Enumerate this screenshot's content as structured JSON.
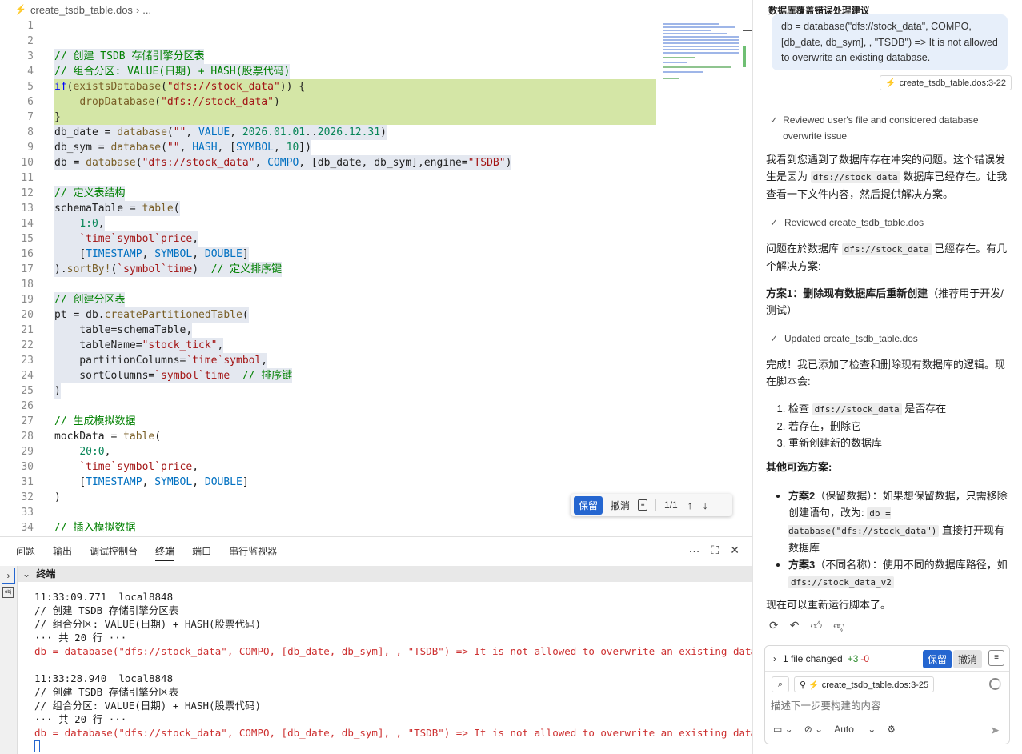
{
  "editor": {
    "breadcrumb_file": "create_tsdb_table.dos",
    "breadcrumb_more": "...",
    "lines": [
      {
        "n": "1",
        "segs": []
      },
      {
        "n": "2",
        "segs": []
      },
      {
        "n": "3",
        "segs": [
          {
            "t": "// 创建 TSDB 存储引擎分区表",
            "c": "c-comment"
          }
        ],
        "hl": "gray"
      },
      {
        "n": "4",
        "segs": [
          {
            "t": "// 组合分区: VALUE(日期) + HASH(股票代码)",
            "c": "c-comment"
          }
        ],
        "hl": "gray"
      },
      {
        "n": "5",
        "segs": [
          {
            "t": "if",
            "c": "c-kw"
          },
          {
            "t": "("
          },
          {
            "t": "existsDatabase",
            "c": "c-fn"
          },
          {
            "t": "("
          },
          {
            "t": "\"dfs://stock_data\"",
            "c": "c-str"
          },
          {
            "t": ")) {"
          }
        ],
        "hl": "green"
      },
      {
        "n": "6",
        "segs": [
          {
            "t": "    "
          },
          {
            "t": "dropDatabase",
            "c": "c-fn"
          },
          {
            "t": "("
          },
          {
            "t": "\"dfs://stock_data\"",
            "c": "c-str"
          },
          {
            "t": ")"
          }
        ],
        "hl": "green"
      },
      {
        "n": "7",
        "segs": [
          {
            "t": "}"
          }
        ],
        "hl": "green"
      },
      {
        "n": "8",
        "segs": [
          {
            "t": "db_date = "
          },
          {
            "t": "database",
            "c": "c-fn"
          },
          {
            "t": "("
          },
          {
            "t": "\"\"",
            "c": "c-str"
          },
          {
            "t": ", "
          },
          {
            "t": "VALUE",
            "c": "c-const"
          },
          {
            "t": ", "
          },
          {
            "t": "2026.01.01",
            "c": "c-num"
          },
          {
            "t": ".."
          },
          {
            "t": "2026.12.31",
            "c": "c-num"
          },
          {
            "t": ")"
          }
        ],
        "hl": "gray"
      },
      {
        "n": "9",
        "segs": [
          {
            "t": "db_sym = "
          },
          {
            "t": "database",
            "c": "c-fn"
          },
          {
            "t": "("
          },
          {
            "t": "\"\"",
            "c": "c-str"
          },
          {
            "t": ", "
          },
          {
            "t": "HASH",
            "c": "c-const"
          },
          {
            "t": ", ["
          },
          {
            "t": "SYMBOL",
            "c": "c-const"
          },
          {
            "t": ", "
          },
          {
            "t": "10",
            "c": "c-num"
          },
          {
            "t": "])"
          }
        ],
        "hl": "gray"
      },
      {
        "n": "10",
        "segs": [
          {
            "t": "db = "
          },
          {
            "t": "database",
            "c": "c-fn"
          },
          {
            "t": "("
          },
          {
            "t": "\"dfs://stock_data\"",
            "c": "c-str"
          },
          {
            "t": ", "
          },
          {
            "t": "COMPO",
            "c": "c-const"
          },
          {
            "t": ", [db_date, db_sym],engine="
          },
          {
            "t": "\"TSDB\"",
            "c": "c-str"
          },
          {
            "t": ")"
          }
        ],
        "hl": "gray"
      },
      {
        "n": "11",
        "segs": []
      },
      {
        "n": "12",
        "segs": [
          {
            "t": "// 定义表结构",
            "c": "c-comment"
          }
        ],
        "hl": "gray"
      },
      {
        "n": "13",
        "segs": [
          {
            "t": "schemaTable = "
          },
          {
            "t": "table",
            "c": "c-fn"
          },
          {
            "t": "("
          }
        ],
        "hl": "gray"
      },
      {
        "n": "14",
        "segs": [
          {
            "t": "    "
          },
          {
            "t": "1:0",
            "c": "c-num"
          },
          {
            "t": ","
          }
        ],
        "hl": "gray"
      },
      {
        "n": "15",
        "segs": [
          {
            "t": "    "
          },
          {
            "t": "`time`symbol`price",
            "c": "c-sym"
          },
          {
            "t": ","
          }
        ],
        "hl": "gray"
      },
      {
        "n": "16",
        "segs": [
          {
            "t": "    ["
          },
          {
            "t": "TIMESTAMP",
            "c": "c-const"
          },
          {
            "t": ", "
          },
          {
            "t": "SYMBOL",
            "c": "c-const"
          },
          {
            "t": ", "
          },
          {
            "t": "DOUBLE",
            "c": "c-const"
          },
          {
            "t": "]"
          }
        ],
        "hl": "gray"
      },
      {
        "n": "17",
        "segs": [
          {
            "t": ")."
          },
          {
            "t": "sortBy!",
            "c": "c-fn"
          },
          {
            "t": "("
          },
          {
            "t": "`symbol`time",
            "c": "c-sym"
          },
          {
            "t": ")  "
          },
          {
            "t": "// 定义排序键",
            "c": "c-comment"
          }
        ],
        "hl": "gray"
      },
      {
        "n": "18",
        "segs": []
      },
      {
        "n": "19",
        "segs": [
          {
            "t": "// 创建分区表",
            "c": "c-comment"
          }
        ],
        "hl": "gray"
      },
      {
        "n": "20",
        "segs": [
          {
            "t": "pt = db."
          },
          {
            "t": "createPartitionedTable",
            "c": "c-fn"
          },
          {
            "t": "("
          }
        ],
        "hl": "gray"
      },
      {
        "n": "21",
        "segs": [
          {
            "t": "    table=schemaTable,"
          }
        ],
        "hl": "gray"
      },
      {
        "n": "22",
        "segs": [
          {
            "t": "    tableName="
          },
          {
            "t": "\"stock_tick\"",
            "c": "c-str"
          },
          {
            "t": ","
          }
        ],
        "hl": "gray"
      },
      {
        "n": "23",
        "segs": [
          {
            "t": "    partitionColumns="
          },
          {
            "t": "`time`symbol",
            "c": "c-sym"
          },
          {
            "t": ","
          }
        ],
        "hl": "gray"
      },
      {
        "n": "24",
        "segs": [
          {
            "t": "    sortColumns="
          },
          {
            "t": "`symbol`time",
            "c": "c-sym"
          },
          {
            "t": "  "
          },
          {
            "t": "// 排序键",
            "c": "c-comment"
          }
        ],
        "hl": "gray"
      },
      {
        "n": "25",
        "segs": [
          {
            "t": ")"
          }
        ],
        "hl": "gray"
      },
      {
        "n": "26",
        "segs": []
      },
      {
        "n": "27",
        "segs": [
          {
            "t": "// 生成模拟数据",
            "c": "c-comment"
          }
        ]
      },
      {
        "n": "28",
        "segs": [
          {
            "t": "mockData = "
          },
          {
            "t": "table",
            "c": "c-fn"
          },
          {
            "t": "("
          }
        ]
      },
      {
        "n": "29",
        "segs": [
          {
            "t": "    "
          },
          {
            "t": "20:0",
            "c": "c-num"
          },
          {
            "t": ","
          }
        ]
      },
      {
        "n": "30",
        "segs": [
          {
            "t": "    "
          },
          {
            "t": "`time`symbol`price",
            "c": "c-sym"
          },
          {
            "t": ","
          }
        ]
      },
      {
        "n": "31",
        "segs": [
          {
            "t": "    ["
          },
          {
            "t": "TIMESTAMP",
            "c": "c-const"
          },
          {
            "t": ", "
          },
          {
            "t": "SYMBOL",
            "c": "c-const"
          },
          {
            "t": ", "
          },
          {
            "t": "DOUBLE",
            "c": "c-const"
          },
          {
            "t": "]"
          }
        ]
      },
      {
        "n": "32",
        "segs": [
          {
            "t": ")"
          }
        ]
      },
      {
        "n": "33",
        "segs": []
      },
      {
        "n": "34",
        "segs": [
          {
            "t": "// 插入模拟数据",
            "c": "c-comment"
          }
        ]
      }
    ],
    "diff_bar": {
      "keep_label": "保留",
      "undo_label": "撤消",
      "count": "1/1"
    }
  },
  "panel": {
    "tabs": [
      "问题",
      "输出",
      "调试控制台",
      "终端",
      "端口",
      "串行监视器"
    ],
    "active_tab": "终端",
    "terminal_title": "终端",
    "lines": [
      {
        "t": "11:33:09.771  local8848",
        "err": false
      },
      {
        "t": "// 创建 TSDB 存储引擎分区表",
        "err": false
      },
      {
        "t": "// 组合分区: VALUE(日期) + HASH(股票代码)",
        "err": false
      },
      {
        "t": "··· 共 20 行 ···",
        "err": false
      },
      {
        "t": "db = database(\"dfs://stock_data\", COMPO, [db_date, db_sym], , \"TSDB\") => It is not allowed to overwrite an existing database.",
        "err": true
      },
      {
        "t": "",
        "err": false
      },
      {
        "t": "11:33:28.940  local8848",
        "err": false
      },
      {
        "t": "// 创建 TSDB 存储引擎分区表",
        "err": false
      },
      {
        "t": "// 组合分区: VALUE(日期) + HASH(股票代码)",
        "err": false
      },
      {
        "t": "··· 共 20 行 ···",
        "err": false
      },
      {
        "t": "db = database(\"dfs://stock_data\", COMPO, [db_date, db_sym], , \"TSDB\") => It is not allowed to overwrite an existing database.",
        "err": true
      }
    ]
  },
  "chat": {
    "title": "数据库覆盖错误处理建议",
    "user_message": "db = database(\"dfs://stock_data\", COMPO, [db_date, db_sym], , \"TSDB\") => It is not allowed to overwrite an existing database.",
    "user_ref": "create_tsdb_table.dos:3-22",
    "step1": "Reviewed user's file and considered database overwrite issue",
    "para1_a": "我看到您遇到了数据库存在冲突的问题。这个错误发生是因为 ",
    "para1_code": "dfs://stock_data",
    "para1_b": " 数据库已经存在。让我查看一下文件内容，然后提供解决方案。",
    "step2": "Reviewed create_tsdb_table.dos",
    "para2_a": "问题在於数据库 ",
    "para2_code": "dfs://stock_data",
    "para2_b": " 已經存在。有几个解决方案:",
    "plan1_bold": "方案1：删除现有数据库后重新创建",
    "plan1_rest": "（推荐用于开发/测试）",
    "step3": "Updated create_tsdb_table.dos",
    "para3": "完成！我已添加了检查和删除现有数据库的逻辑。现在脚本会:",
    "list1": [
      {
        "a": "检查 ",
        "code": "dfs://stock_data",
        "b": " 是否存在"
      },
      {
        "a": "若存在，删除它",
        "code": "",
        "b": ""
      },
      {
        "a": "重新创建新的数据库",
        "code": "",
        "b": ""
      }
    ],
    "other_title": "其他可选方案:",
    "opt2_bold": "方案2",
    "opt2_a": "（保留数据）：如果想保留数据，只需移除创建语句，改为: ",
    "opt2_code": "db = database(\"dfs://stock_data\")",
    "opt2_b": " 直接打开现有数据库",
    "opt3_bold": "方案3",
    "opt3_a": "（不同名称）：使用不同的数据库路径，如 ",
    "opt3_code": "dfs://stock_data_v2",
    "final": "现在可以重新运行脚本了。",
    "changes": {
      "summary": "1 file changed",
      "added": "+3",
      "removed": "-0",
      "keep_label": "保留",
      "undo_label": "撤消"
    },
    "context_chip": "create_tsdb_table.dos:3-25",
    "input_placeholder": "描述下一步要构建的内容",
    "mode": "Auto"
  }
}
